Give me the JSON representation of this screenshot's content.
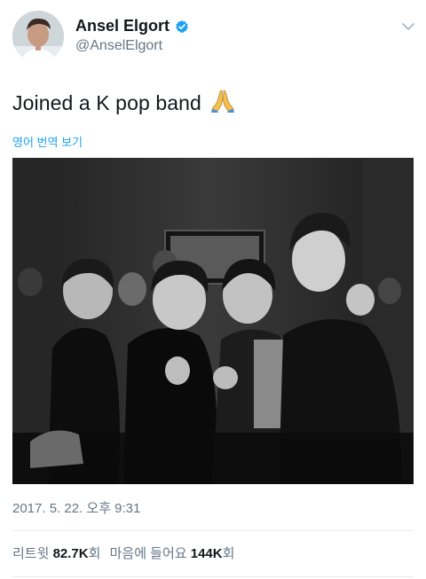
{
  "author": {
    "display_name": "Ansel Elgort",
    "handle": "@AnselElgort",
    "verified": true
  },
  "tweet": {
    "text": "Joined a K pop band",
    "emoji_icon": "folded-hands-icon",
    "translate_label": "영어 번역 보기",
    "timestamp": "2017. 5. 22. 오후 9:31"
  },
  "stats": {
    "retweets_label": "리트윗",
    "retweets_count": "82.7K",
    "retweets_suffix": "회",
    "likes_label": "마음에 들어요",
    "likes_count": "144K",
    "likes_suffix": "회"
  },
  "colors": {
    "link": "#1da1f2",
    "secondary_text": "#657786",
    "primary_text": "#14171a"
  }
}
